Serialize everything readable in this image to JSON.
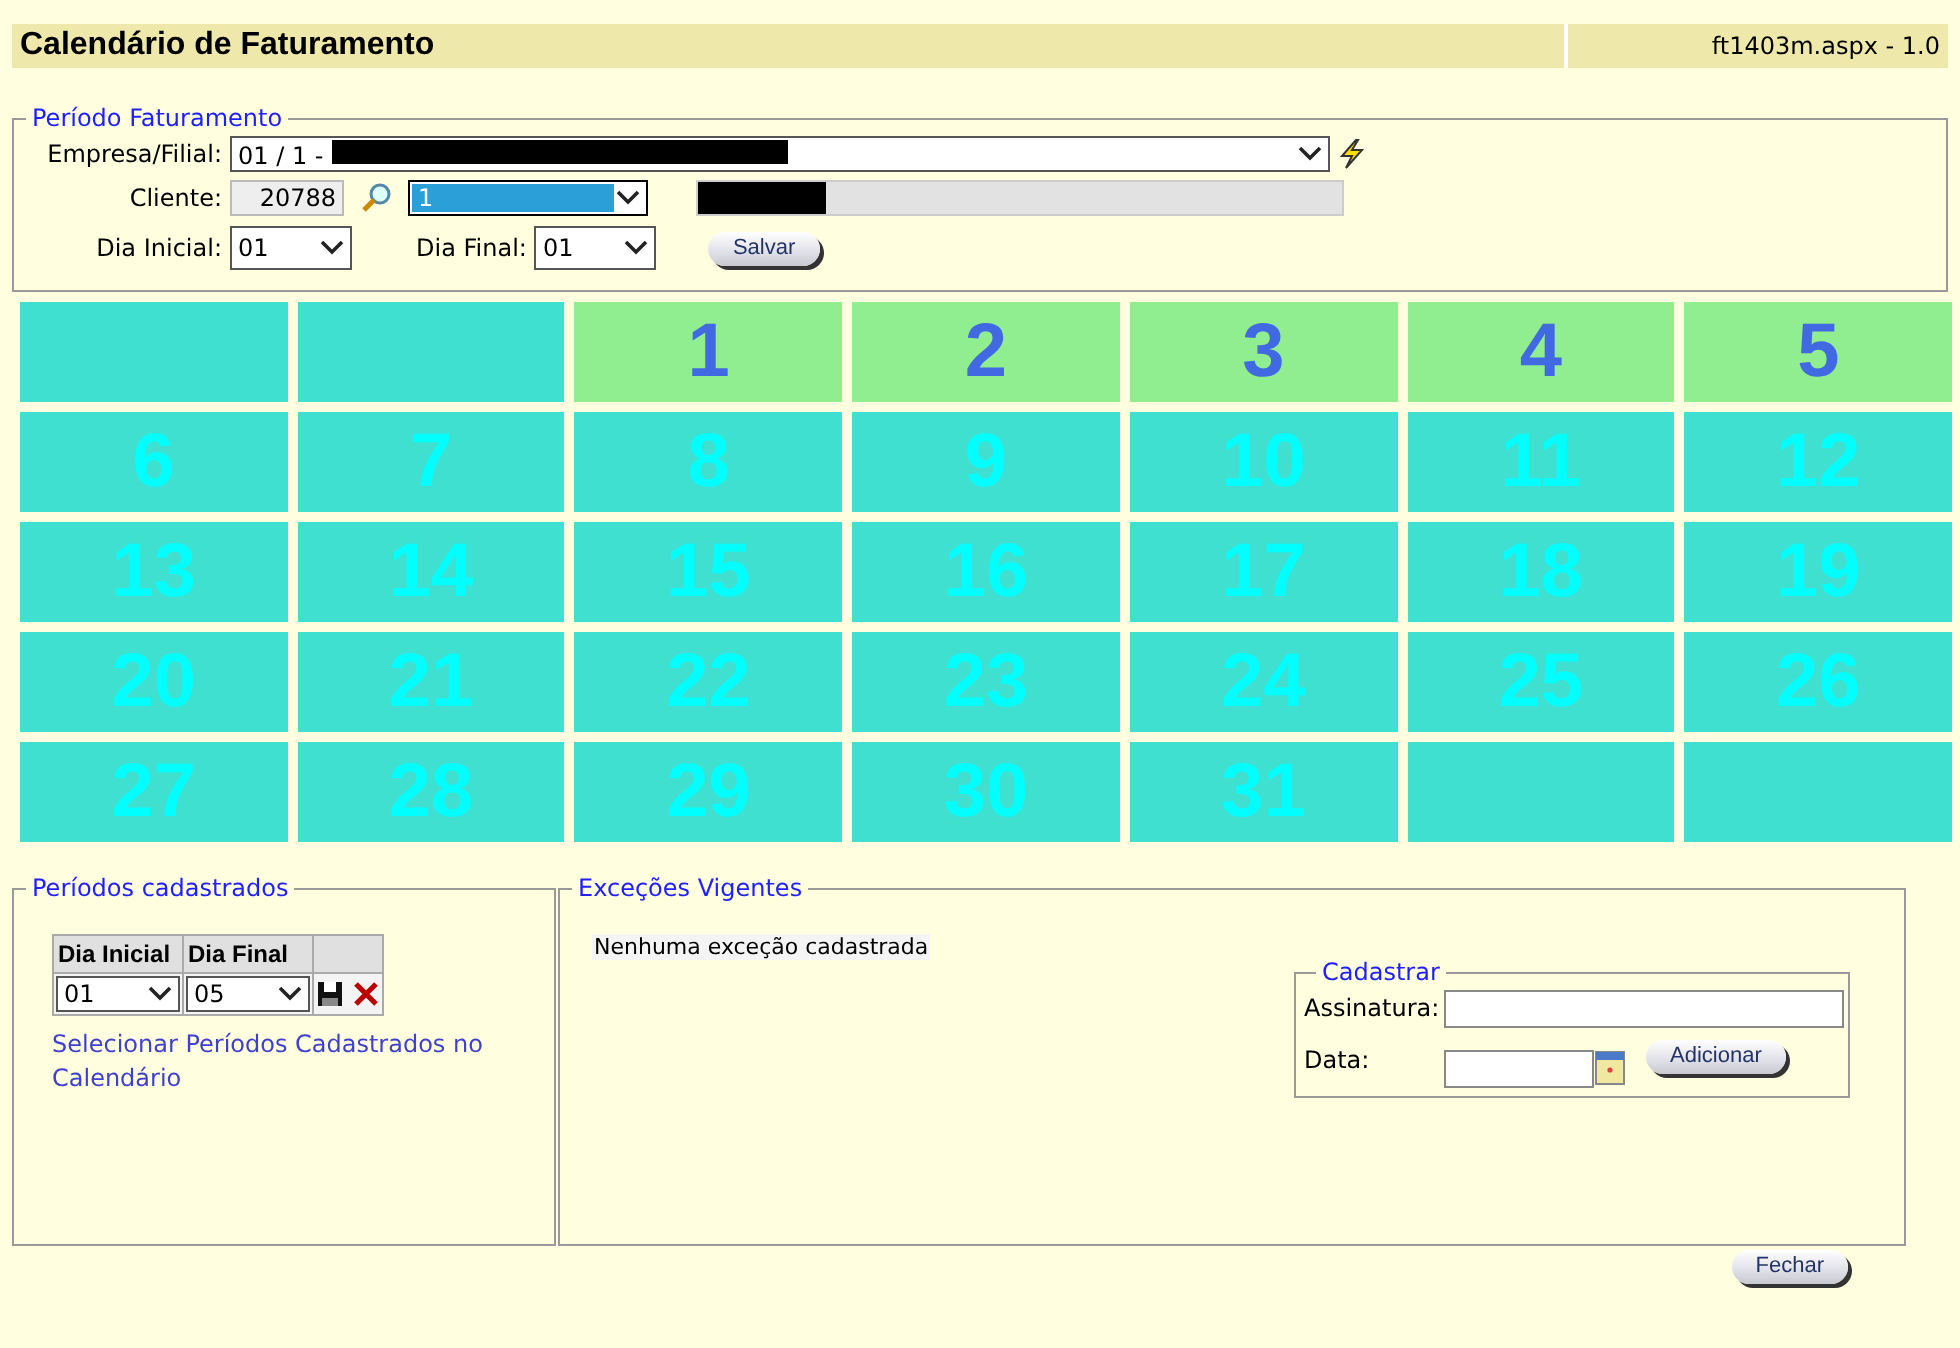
{
  "title": "Calendário de Faturamento",
  "version": "ft1403m.aspx - 1.0",
  "periodo": {
    "legend": "Período Faturamento",
    "empresa_label": "Empresa/Filial:",
    "empresa_value": "01 / 1 -",
    "cliente_label": "Cliente:",
    "cliente_code": "20788",
    "cliente_select": "1",
    "dia_inicial_label": "Dia Inicial:",
    "dia_inicial": "01",
    "dia_final_label": "Dia Final:",
    "dia_final": "01",
    "save_button": "Salvar"
  },
  "calendar": [
    [
      {
        "kind": "empty"
      },
      {
        "kind": "empty"
      },
      {
        "kind": "day",
        "day": "1",
        "selected": true
      },
      {
        "kind": "day",
        "day": "2",
        "selected": true
      },
      {
        "kind": "day",
        "day": "3",
        "selected": true
      },
      {
        "kind": "day",
        "day": "4",
        "selected": true
      },
      {
        "kind": "day",
        "day": "5",
        "selected": true
      }
    ],
    [
      {
        "kind": "day",
        "day": "6",
        "selected": false
      },
      {
        "kind": "day",
        "day": "7",
        "selected": false
      },
      {
        "kind": "day",
        "day": "8",
        "selected": false
      },
      {
        "kind": "day",
        "day": "9",
        "selected": false
      },
      {
        "kind": "day",
        "day": "10",
        "selected": false
      },
      {
        "kind": "day",
        "day": "11",
        "selected": false
      },
      {
        "kind": "day",
        "day": "12",
        "selected": false
      }
    ],
    [
      {
        "kind": "day",
        "day": "13",
        "selected": false
      },
      {
        "kind": "day",
        "day": "14",
        "selected": false
      },
      {
        "kind": "day",
        "day": "15",
        "selected": false
      },
      {
        "kind": "day",
        "day": "16",
        "selected": false
      },
      {
        "kind": "day",
        "day": "17",
        "selected": false
      },
      {
        "kind": "day",
        "day": "18",
        "selected": false
      },
      {
        "kind": "day",
        "day": "19",
        "selected": false
      }
    ],
    [
      {
        "kind": "day",
        "day": "20",
        "selected": false
      },
      {
        "kind": "day",
        "day": "21",
        "selected": false
      },
      {
        "kind": "day",
        "day": "22",
        "selected": false
      },
      {
        "kind": "day",
        "day": "23",
        "selected": false
      },
      {
        "kind": "day",
        "day": "24",
        "selected": false
      },
      {
        "kind": "day",
        "day": "25",
        "selected": false
      },
      {
        "kind": "day",
        "day": "26",
        "selected": false
      }
    ],
    [
      {
        "kind": "day",
        "day": "27",
        "selected": false
      },
      {
        "kind": "day",
        "day": "28",
        "selected": false
      },
      {
        "kind": "day",
        "day": "29",
        "selected": false
      },
      {
        "kind": "day",
        "day": "30",
        "selected": false
      },
      {
        "kind": "day",
        "day": "31",
        "selected": false
      },
      {
        "kind": "empty"
      },
      {
        "kind": "empty"
      }
    ]
  ],
  "periodos": {
    "legend": "Períodos cadastrados",
    "columns": [
      "Dia Inicial",
      "Dia Final"
    ],
    "rows": [
      {
        "dia_inicial": "01",
        "dia_final": "05"
      }
    ],
    "link": "Selecionar Períodos Cadastrados no Calendário"
  },
  "excecoes": {
    "legend": "Exceções Vigentes",
    "message": "Nenhuma exceção cadastrada",
    "cadastrar": {
      "legend": "Cadastrar",
      "assinatura_label": "Assinatura:",
      "data_label": "Data:",
      "button": "Adicionar"
    }
  },
  "close_button": "Fechar"
}
